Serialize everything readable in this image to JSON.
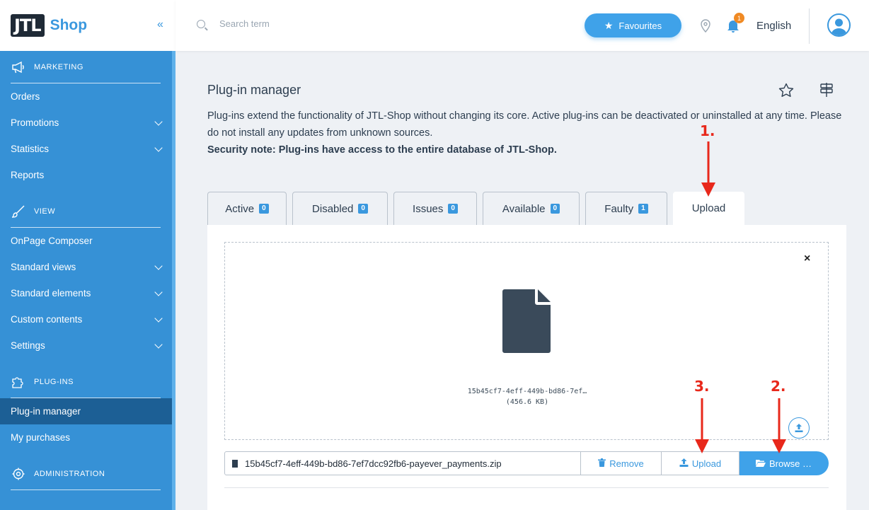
{
  "brand": {
    "logo_box": "JTL",
    "logo_text": "Shop",
    "collapse": "«"
  },
  "sidebar": {
    "sections": [
      {
        "label": "MARKETING",
        "icon": "megaphone-icon",
        "items": [
          {
            "label": "Orders",
            "expandable": false
          },
          {
            "label": "Promotions",
            "expandable": true
          },
          {
            "label": "Statistics",
            "expandable": true
          },
          {
            "label": "Reports",
            "expandable": false
          }
        ]
      },
      {
        "label": "VIEW",
        "icon": "brush-icon",
        "items": [
          {
            "label": "OnPage Composer",
            "expandable": false
          },
          {
            "label": "Standard views",
            "expandable": true
          },
          {
            "label": "Standard elements",
            "expandable": true
          },
          {
            "label": "Custom contents",
            "expandable": true
          },
          {
            "label": "Settings",
            "expandable": true
          }
        ]
      },
      {
        "label": "PLUG-INS",
        "icon": "puzzle-icon",
        "items": [
          {
            "label": "Plug-in manager",
            "expandable": false,
            "active": true
          },
          {
            "label": "My purchases",
            "expandable": false
          }
        ]
      },
      {
        "label": "ADMINISTRATION",
        "icon": "gear-icon",
        "items": []
      }
    ]
  },
  "header": {
    "search_placeholder": "Search term",
    "favourites_label": "Favourites",
    "notification_count": "1",
    "language": "English"
  },
  "page": {
    "title": "Plug-in manager",
    "description": "Plug-ins extend the functionality of JTL-Shop without changing its core. Active plug-ins can be deactivated or uninstalled at any time. Please do not install any updates from unknown sources.",
    "security_note": "Security note: Plug-ins have access to the entire database of JTL-Shop."
  },
  "tabs": [
    {
      "label": "Active",
      "count": "0"
    },
    {
      "label": "Disabled",
      "count": "0"
    },
    {
      "label": "Issues",
      "count": "0"
    },
    {
      "label": "Available",
      "count": "0"
    },
    {
      "label": "Faulty",
      "count": "1"
    },
    {
      "label": "Upload",
      "count": null,
      "current": true
    }
  ],
  "upload": {
    "close": "×",
    "preview_name": "15b45cf7-4eff-449b-bd86-7ef…",
    "preview_size": "(456.6 KB)",
    "file_name": "15b45cf7-4eff-449b-bd86-7ef7dcc92fb6-payever_payments.zip",
    "remove_label": "Remove",
    "upload_label": "Upload",
    "browse_label": "Browse …"
  },
  "annotations": {
    "step1": "1.",
    "step2": "2.",
    "step3": "3.",
    "color": "#e8281b"
  },
  "colors": {
    "sidebar": "#3691d6",
    "accent": "#3fa2e9",
    "active_nav": "#1c5f95",
    "badge_orange": "#f08a24"
  }
}
